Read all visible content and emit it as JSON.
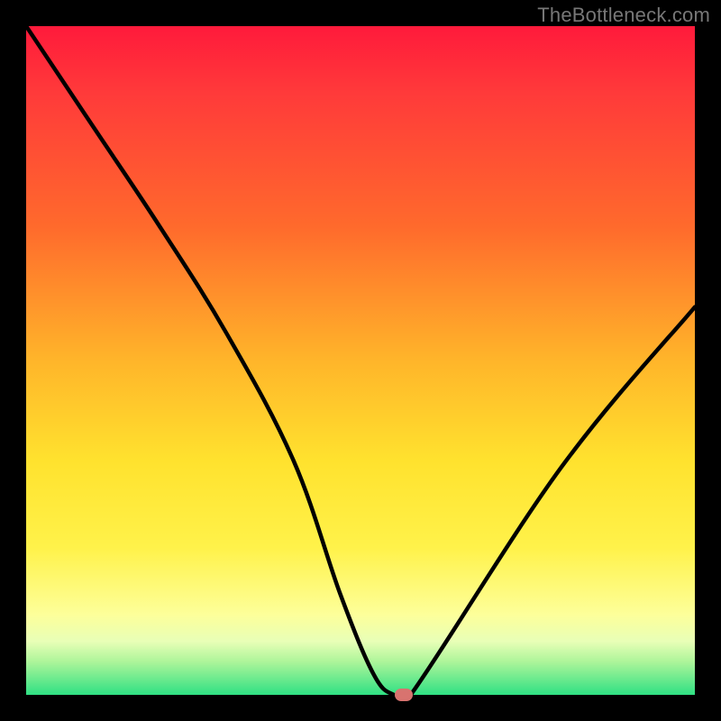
{
  "watermark": "TheBottleneck.com",
  "colors": {
    "curve_stroke": "#000000",
    "marker_fill": "#d8736f"
  },
  "chart_data": {
    "type": "line",
    "title": "",
    "xlabel": "",
    "ylabel": "",
    "xlim": [
      0,
      100
    ],
    "ylim": [
      0,
      100
    ],
    "grid": false,
    "legend": false,
    "series": [
      {
        "name": "bottleneck-curve",
        "x": [
          0,
          10,
          20,
          30,
          40,
          47,
          52,
          55,
          57.5,
          80,
          100
        ],
        "y": [
          100,
          85,
          70,
          54,
          35,
          15,
          3,
          0,
          0,
          34,
          58
        ]
      }
    ],
    "marker": {
      "x": 56.5,
      "y": 0
    },
    "note": "x/y values estimated from pixel positions; axes unlabeled in source image"
  }
}
